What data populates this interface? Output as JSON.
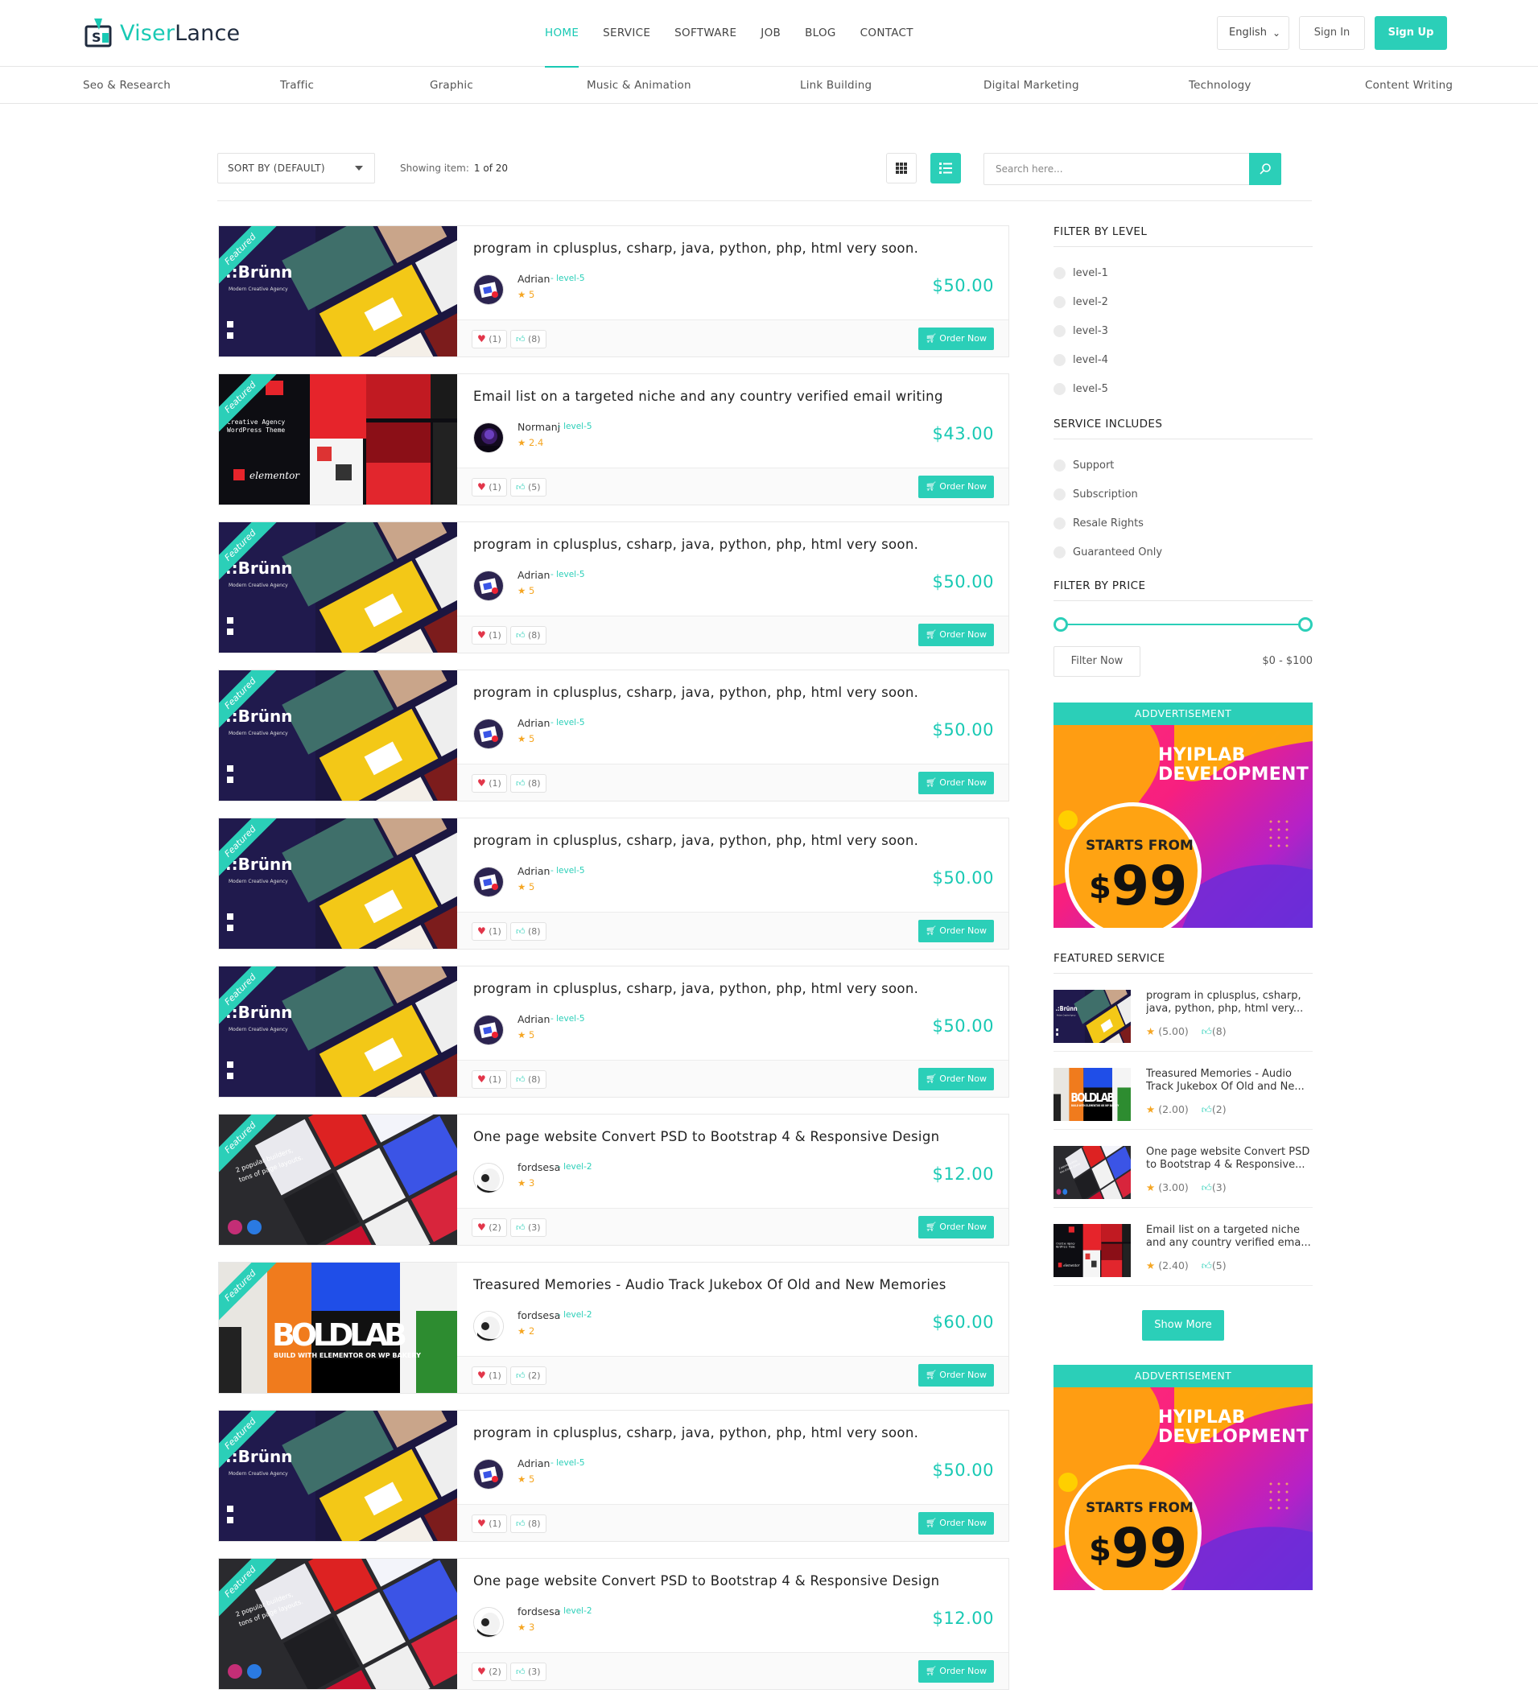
{
  "brand": {
    "part1": "Viser",
    "part2": "Lance"
  },
  "nav": {
    "items": [
      "HOME",
      "SERVICE",
      "SOFTWARE",
      "JOB",
      "BLOG",
      "CONTACT"
    ],
    "active": "HOME"
  },
  "header": {
    "language": "English",
    "sign_in": "Sign In",
    "sign_up": "Sign Up"
  },
  "categories": [
    "Seo & Research",
    "Traffic",
    "Graphic",
    "Music & Animation",
    "Link Building",
    "Digital Marketing",
    "Technology",
    "Content Writing"
  ],
  "toolbar": {
    "sort_label": "SORT BY (DEFAULT)",
    "showing_label": "Showing item:",
    "showing_value": "1 of 20",
    "search_placeholder": "Search here..."
  },
  "services": [
    {
      "title": "program in cplusplus, csharp, java, python, php, html very soon.",
      "seller": "Adrian",
      "level": "- level-5",
      "rating": "5",
      "price": "$50.00",
      "likes": "(1)",
      "thumbs": "(8)",
      "order": "Order Now",
      "badge": "Featured",
      "thumb": "brunn"
    },
    {
      "title": "Email list on a targeted niche and any country verified email writing",
      "seller": "Normanj",
      "level": "- level-5",
      "rating": "2.4",
      "price": "$43.00",
      "likes": "(1)",
      "thumbs": "(5)",
      "order": "Order Now",
      "badge": "Featured",
      "thumb": "creative"
    },
    {
      "title": "program in cplusplus, csharp, java, python, php, html very soon.",
      "seller": "Adrian",
      "level": "- level-5",
      "rating": "5",
      "price": "$50.00",
      "likes": "(1)",
      "thumbs": "(8)",
      "order": "Order Now",
      "badge": "Featured",
      "thumb": "brunn"
    },
    {
      "title": "program in cplusplus, csharp, java, python, php, html very soon.",
      "seller": "Adrian",
      "level": "- level-5",
      "rating": "5",
      "price": "$50.00",
      "likes": "(1)",
      "thumbs": "(8)",
      "order": "Order Now",
      "badge": "Featured",
      "thumb": "brunn"
    },
    {
      "title": "program in cplusplus, csharp, java, python, php, html very soon.",
      "seller": "Adrian",
      "level": "- level-5",
      "rating": "5",
      "price": "$50.00",
      "likes": "(1)",
      "thumbs": "(8)",
      "order": "Order Now",
      "badge": "Featured",
      "thumb": "brunn"
    },
    {
      "title": "program in cplusplus, csharp, java, python, php, html very soon.",
      "seller": "Adrian",
      "level": "- level-5",
      "rating": "5",
      "price": "$50.00",
      "likes": "(1)",
      "thumbs": "(8)",
      "order": "Order Now",
      "badge": "Featured",
      "thumb": "brunn"
    },
    {
      "title": "One page website Convert PSD to Bootstrap 4 & Responsive Design",
      "seller": "fordsesa",
      "level": "- level-2",
      "rating": "3",
      "price": "$12.00",
      "likes": "(2)",
      "thumbs": "(3)",
      "order": "Order Now",
      "badge": "Featured",
      "thumb": "builders"
    },
    {
      "title": "Treasured Memories - Audio Track Jukebox Of Old and New Memories",
      "seller": "fordsesa",
      "level": "- level-2",
      "rating": "2",
      "price": "$60.00",
      "likes": "(1)",
      "thumbs": "(2)",
      "order": "Order Now",
      "badge": "Featured",
      "thumb": "boldlab"
    },
    {
      "title": "program in cplusplus, csharp, java, python, php, html very soon.",
      "seller": "Adrian",
      "level": "- level-5",
      "rating": "5",
      "price": "$50.00",
      "likes": "(1)",
      "thumbs": "(8)",
      "order": "Order Now",
      "badge": "Featured",
      "thumb": "brunn"
    },
    {
      "title": "One page website Convert PSD to Bootstrap 4 & Responsive Design",
      "seller": "fordsesa",
      "level": "- level-2",
      "rating": "3",
      "price": "$12.00",
      "likes": "(2)",
      "thumbs": "(3)",
      "order": "Order Now",
      "badge": "Featured",
      "thumb": "builders"
    }
  ],
  "sidebar": {
    "level_heading": "FILTER BY LEVEL",
    "levels": [
      "level-1",
      "level-2",
      "level-3",
      "level-4",
      "level-5"
    ],
    "includes_heading": "SERVICE INCLUDES",
    "includes": [
      "Support",
      "Subscription",
      "Resale Rights",
      "Guaranteed Only"
    ],
    "price_heading": "FILTER BY PRICE",
    "price_filter_button": "Filter Now",
    "price_range": "$0 - $100",
    "featured_heading": "FEATURED SERVICE",
    "featured": [
      {
        "title": "program in cplusplus, csharp, java, python, php, html very...",
        "rating": "(5.00)",
        "thumbs": "(8)",
        "thumb": "brunn"
      },
      {
        "title": "Treasured Memories - Audio Track Jukebox Of Old and Ne...",
        "rating": "(2.00)",
        "thumbs": "(2)",
        "thumb": "boldlab"
      },
      {
        "title": "One page website Convert PSD to Bootstrap 4 & Responsive...",
        "rating": "(3.00)",
        "thumbs": "(3)",
        "thumb": "builders"
      },
      {
        "title": "Email list on a targeted niche and any country verified ema...",
        "rating": "(2.40)",
        "thumbs": "(5)",
        "thumb": "creative"
      }
    ],
    "show_more": "Show More",
    "ads": [
      {
        "header": "ADDVERTISEMENT",
        "title": "HYIPLAB DEVELOPMENT",
        "starts": "STARTS FROM",
        "currency": "$",
        "amount": "99"
      },
      {
        "header": "ADDVERTISEMENT",
        "title": "HYIPLAB DEVELOPMENT",
        "starts": "STARTS FROM",
        "currency": "$",
        "amount": "99"
      }
    ]
  },
  "colors": {
    "accent": "#2bcfb8",
    "accent_dark": "#19c9b4",
    "heart": "#e2364a",
    "star": "#f5a623"
  }
}
